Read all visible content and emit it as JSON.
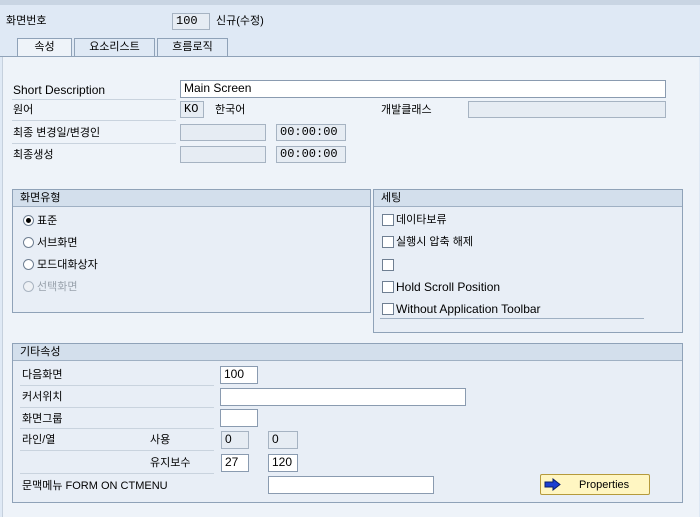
{
  "header": {
    "screen_number_label": "화면번호",
    "screen_number": "100",
    "status": "신규(수정)"
  },
  "tabs": [
    {
      "label": "속성",
      "active": true
    },
    {
      "label": "요소리스트",
      "active": false
    },
    {
      "label": "흐름로직",
      "active": false
    }
  ],
  "attributes": {
    "short_description_label": "Short Description",
    "short_description": "Main Screen",
    "original_language_label": "원어",
    "original_language_code": "KO",
    "original_language_name": "한국어",
    "dev_class_label": "개발클래스",
    "dev_class": "",
    "last_changed_label": "최종 변경일/변경인",
    "last_changed_date": "",
    "last_changed_time": "00:00:00",
    "last_generated_label": "최종생성",
    "last_generated_date": "",
    "last_generated_time": "00:00:00"
  },
  "screen_type": {
    "title": "화면유형",
    "options": [
      {
        "label": "표준",
        "selected": true,
        "disabled": false
      },
      {
        "label": "서브화면",
        "selected": false,
        "disabled": false
      },
      {
        "label": "모드대화상자",
        "selected": false,
        "disabled": false
      },
      {
        "label": "선택화면",
        "selected": false,
        "disabled": true
      }
    ]
  },
  "settings": {
    "title": "세팅",
    "options": [
      {
        "label": "데이타보류",
        "checked": false
      },
      {
        "label": "실행시 압축 해제",
        "checked": false
      },
      {
        "label": "",
        "checked": false
      },
      {
        "label": "Hold Scroll Position",
        "checked": false
      },
      {
        "label": "Without Application Toolbar",
        "checked": false
      }
    ]
  },
  "other": {
    "title": "기타속성",
    "next_screen_label": "다음화면",
    "next_screen": "100",
    "cursor_position_label": "커서위치",
    "cursor_position": "",
    "screen_group_label": "화면그룹",
    "screen_group": "",
    "lines_columns_label": "라인/열",
    "used_label": "사용",
    "used_lines": "0",
    "used_columns": "0",
    "maintenance_label": "유지보수",
    "maintenance_lines": "27",
    "maintenance_columns": "120",
    "context_menu_label": "문맥메뉴 FORM ON CTMENU",
    "context_menu": "",
    "properties_button": "Properties"
  },
  "colors": {
    "background": "#dfe9f5",
    "button_bg": "#fff6c2",
    "arrow_icon": "#1b3fd1"
  }
}
